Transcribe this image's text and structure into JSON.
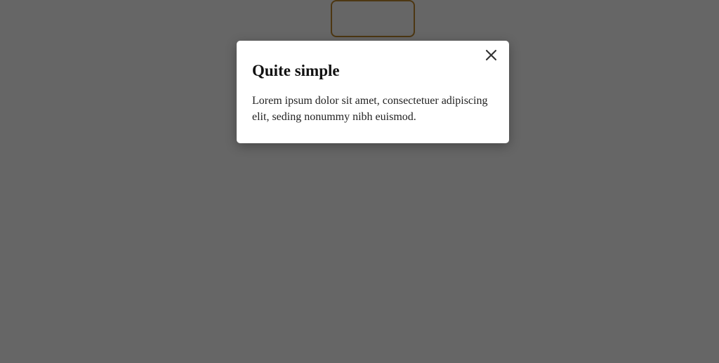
{
  "modal": {
    "title": "Quite simple",
    "body": "Lorem ipsum dolor sit amet, consectetuer adipiscing elit, seding nonummy nibh euismod."
  }
}
